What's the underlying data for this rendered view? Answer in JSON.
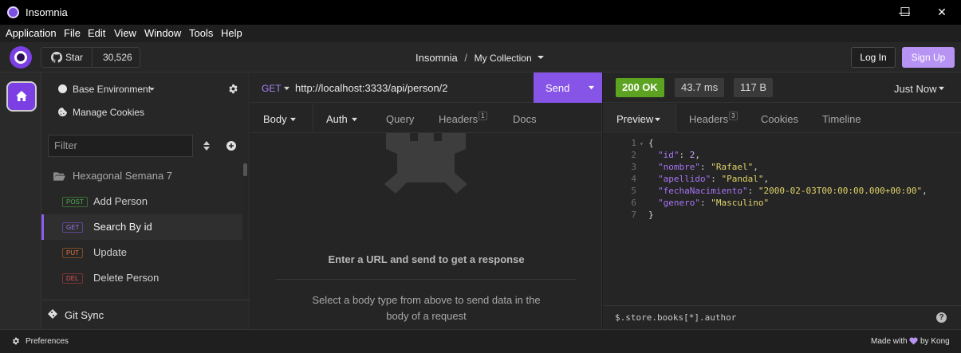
{
  "window": {
    "title": "Insomnia",
    "minimize_glyph": "—",
    "maximize_glyph": "☐",
    "close_glyph": "✕"
  },
  "menu": [
    "Application",
    "File",
    "Edit",
    "View",
    "Window",
    "Tools",
    "Help"
  ],
  "header": {
    "star_label": "Star",
    "star_count": "30,526",
    "breadcrumb_project": "Insomnia",
    "breadcrumb_sep": "/",
    "breadcrumb_collection": "My Collection",
    "login_label": "Log In",
    "signup_label": "Sign Up"
  },
  "sidebar": {
    "environment_label": "Base Environment",
    "cookies_label": "Manage Cookies",
    "filter_placeholder": "Filter",
    "folder_name": "Hexagonal Semana 7",
    "requests": [
      {
        "method": "POST",
        "name": "Add Person"
      },
      {
        "method": "GET",
        "name": "Search By id"
      },
      {
        "method": "PUT",
        "name": "Update"
      },
      {
        "method": "DEL",
        "name": "Delete Person"
      }
    ],
    "git_sync_label": "Git Sync"
  },
  "request": {
    "method": "GET",
    "url": "http://localhost:3333/api/person/2",
    "send_label": "Send",
    "tabs": {
      "body": "Body",
      "auth": "Auth",
      "query": "Query",
      "headers": "Headers",
      "headers_count": "1",
      "docs": "Docs"
    },
    "empty_title": "Enter a URL and send to get a response",
    "empty_body_line1": "Select a body type from above to send data in the",
    "empty_body_line2": "body of a request"
  },
  "response": {
    "status": "200 OK",
    "time": "43.7 ms",
    "size": "117 B",
    "when": "Just Now",
    "tabs": {
      "preview": "Preview",
      "headers": "Headers",
      "headers_count": "3",
      "cookies": "Cookies",
      "timeline": "Timeline"
    },
    "line_numbers": [
      "1",
      "2",
      "3",
      "4",
      "5",
      "6",
      "7"
    ],
    "json": {
      "id_key": "\"id\"",
      "id_val": "2",
      "nombre_key": "\"nombre\"",
      "nombre_val": "\"Rafael\"",
      "apellido_key": "\"apellido\"",
      "apellido_val": "\"Pandal\"",
      "fecha_key": "\"fechaNacimiento\"",
      "fecha_val": "\"2000-02-03T00:00:00.000+00:00\"",
      "genero_key": "\"genero\"",
      "genero_val": "\"Masculino\""
    },
    "filter_expression": "$.store.books[*].author",
    "help_glyph": "?"
  },
  "statusbar": {
    "preferences_label": "Preferences",
    "made_with": "Made with",
    "by_kong": "by Kong"
  },
  "colors": {
    "accent": "#8754e8",
    "status_ok": "#68b52b",
    "post": "#4caf50",
    "get": "#9d75f0",
    "put": "#e07a39",
    "del": "#e05252"
  }
}
